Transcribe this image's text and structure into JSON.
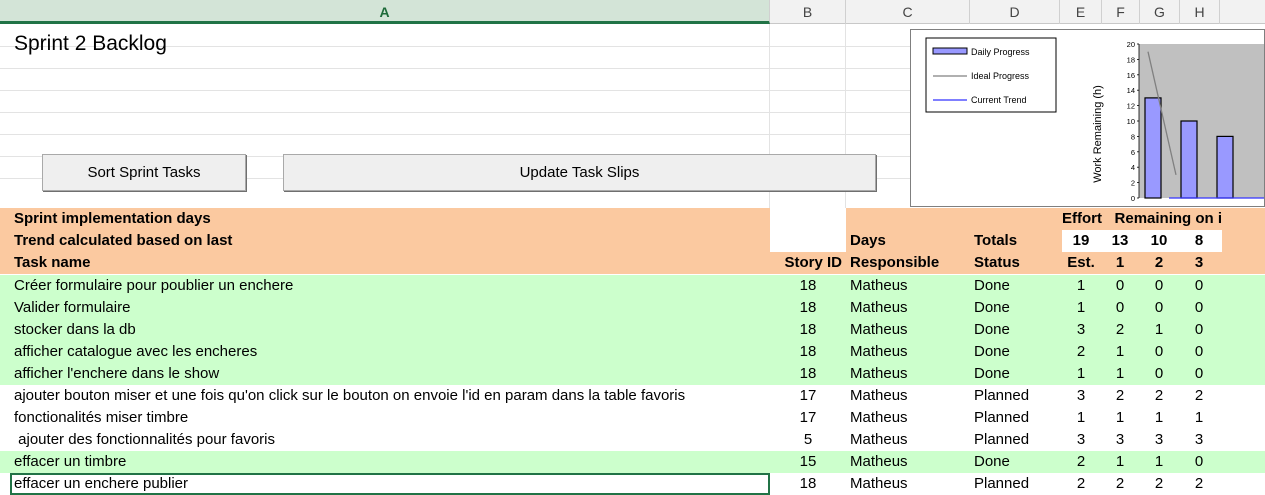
{
  "columns": [
    "A",
    "B",
    "C",
    "D",
    "E",
    "F",
    "G",
    "H"
  ],
  "active_column": "A",
  "title": "Sprint 2 Backlog",
  "buttons": {
    "sort": "Sort Sprint Tasks",
    "update": "Update Task Slips"
  },
  "header": {
    "row1_label": "Sprint implementation days",
    "row2_label": "Trend calculated based on last",
    "effort": "Effort",
    "remaining": "Remaining on i",
    "days": "Days",
    "totals": "Totals",
    "total_est": "19",
    "total_d1": "13",
    "total_d2": "10",
    "total_d3": "8",
    "task_name": "Task name",
    "story_id": "Story ID",
    "responsible": "Responsible",
    "status": "Status",
    "est": "Est.",
    "d1": "1",
    "d2": "2",
    "d3": "3"
  },
  "tasks": [
    {
      "name": "Créer formulaire pour poublier un enchere",
      "story": "18",
      "resp": "Matheus",
      "status": "Done",
      "est": "1",
      "d1": "0",
      "d2": "0",
      "d3": "0"
    },
    {
      "name": "Valider formulaire",
      "story": "18",
      "resp": "Matheus",
      "status": "Done",
      "est": "1",
      "d1": "0",
      "d2": "0",
      "d3": "0"
    },
    {
      "name": "stocker dans la db",
      "story": "18",
      "resp": "Matheus",
      "status": "Done",
      "est": "3",
      "d1": "2",
      "d2": "1",
      "d3": "0"
    },
    {
      "name": "afficher catalogue avec les encheres",
      "story": "18",
      "resp": "Matheus",
      "status": "Done",
      "est": "2",
      "d1": "1",
      "d2": "0",
      "d3": "0"
    },
    {
      "name": "afficher l'enchere dans le show",
      "story": "18",
      "resp": "Matheus",
      "status": "Done",
      "est": "1",
      "d1": "1",
      "d2": "0",
      "d3": "0"
    },
    {
      "name": "ajouter bouton miser et une fois qu'on click sur le bouton on envoie l'id en param dans la table favoris",
      "story": "17",
      "resp": "Matheus",
      "status": "Planned",
      "est": "3",
      "d1": "2",
      "d2": "2",
      "d3": "2"
    },
    {
      "name": "fonctionalités miser timbre",
      "story": "17",
      "resp": "Matheus",
      "status": "Planned",
      "est": "1",
      "d1": "1",
      "d2": "1",
      "d3": "1"
    },
    {
      "name": " ajouter des fonctionnalités pour favoris",
      "story": "5",
      "resp": "Matheus",
      "status": "Planned",
      "est": "3",
      "d1": "3",
      "d2": "3",
      "d3": "3"
    },
    {
      "name": "effacer un timbre",
      "story": "15",
      "resp": "Matheus",
      "status": "Done",
      "est": "2",
      "d1": "1",
      "d2": "1",
      "d3": "0"
    },
    {
      "name": "effacer un enchere publier",
      "story": "18",
      "resp": "Matheus",
      "status": "Planned",
      "est": "2",
      "d1": "2",
      "d2": "2",
      "d3": "2"
    }
  ],
  "colors": {
    "done_row": "#ccffcc",
    "header_row": "#fbc9a0",
    "selection": "#217346",
    "bar_fill": "#9999ff",
    "plot_bg": "#c0c0c0"
  },
  "chart_data": {
    "type": "bar",
    "ylabel": "Work Remaining (h)",
    "ylim": [
      0,
      20
    ],
    "yticks": [
      "0",
      "2",
      "4",
      "6",
      "8",
      "10",
      "12",
      "14",
      "16",
      "18",
      "20"
    ],
    "series": [
      {
        "name": "Daily Progress",
        "type": "bar",
        "values": [
          13,
          10,
          8
        ]
      },
      {
        "name": "Ideal Progress",
        "type": "line",
        "values": [
          19,
          3
        ]
      },
      {
        "name": "Current Trend",
        "type": "line",
        "values": [
          0,
          0,
          0
        ]
      }
    ],
    "legend": [
      "Daily Progress",
      "Ideal Progress",
      "Current Trend"
    ],
    "legend_position": "left"
  }
}
